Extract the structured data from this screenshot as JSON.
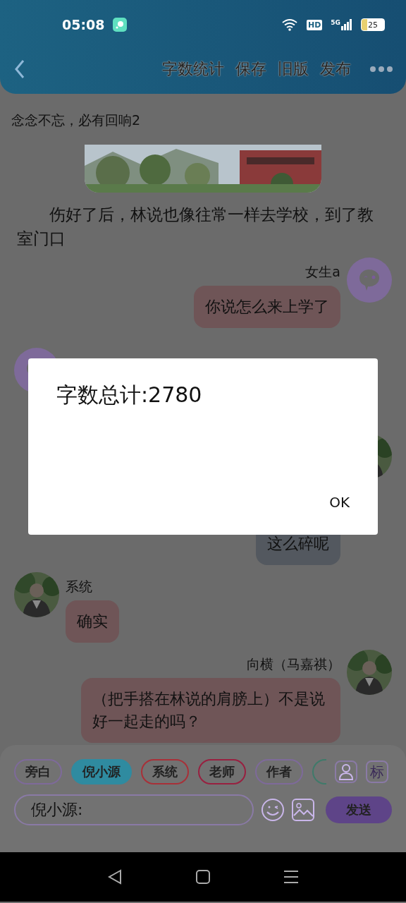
{
  "status_bar": {
    "time": "05:08",
    "hd_badge": "HD",
    "network": "5G",
    "battery": "25"
  },
  "header": {
    "actions": [
      "字数统计",
      "保存",
      "旧版",
      "发布"
    ]
  },
  "title": "念念不忘，必有回响2",
  "narration": "伤好了后，林说也像往常一样去学校，到了教室门口",
  "messages": [
    {
      "kind": "outgoing",
      "name": "女生a",
      "text": "你说怎么来上学了",
      "avatar": {
        "kind": "icon"
      },
      "color": "#6f5557"
    },
    {
      "kind": "incoming",
      "avatar": {
        "kind": "icon"
      }
    },
    {
      "kind": "outgoing",
      "text": "这么碎呢",
      "color": "#53585f"
    },
    {
      "kind": "incoming",
      "name": "系统",
      "text": "确实",
      "color": "#6f5557"
    },
    {
      "kind": "outgoing",
      "name": "向横（马嘉祺）",
      "text": "（把手搭在林说的肩膀上）不是说好一起走的吗？",
      "color": "#6f5557"
    }
  ],
  "dialog": {
    "message": "字数总计:2780",
    "button": "OK"
  },
  "composer": {
    "chips": [
      {
        "label": "旁白",
        "color": "#7e6a9a",
        "selected": false
      },
      {
        "label": "倪小源",
        "color": "#2f8ba0",
        "selected": true
      },
      {
        "label": "系统",
        "color": "#a83038",
        "selected": false
      },
      {
        "label": "老师",
        "color": "#982040",
        "selected": false
      },
      {
        "label": "作者",
        "color": "#7e6a9a",
        "selected": false
      },
      {
        "color": "#3f7a6a",
        "selected": false
      }
    ],
    "tag_button": "标",
    "input": "倪小源:",
    "send": "发送"
  }
}
